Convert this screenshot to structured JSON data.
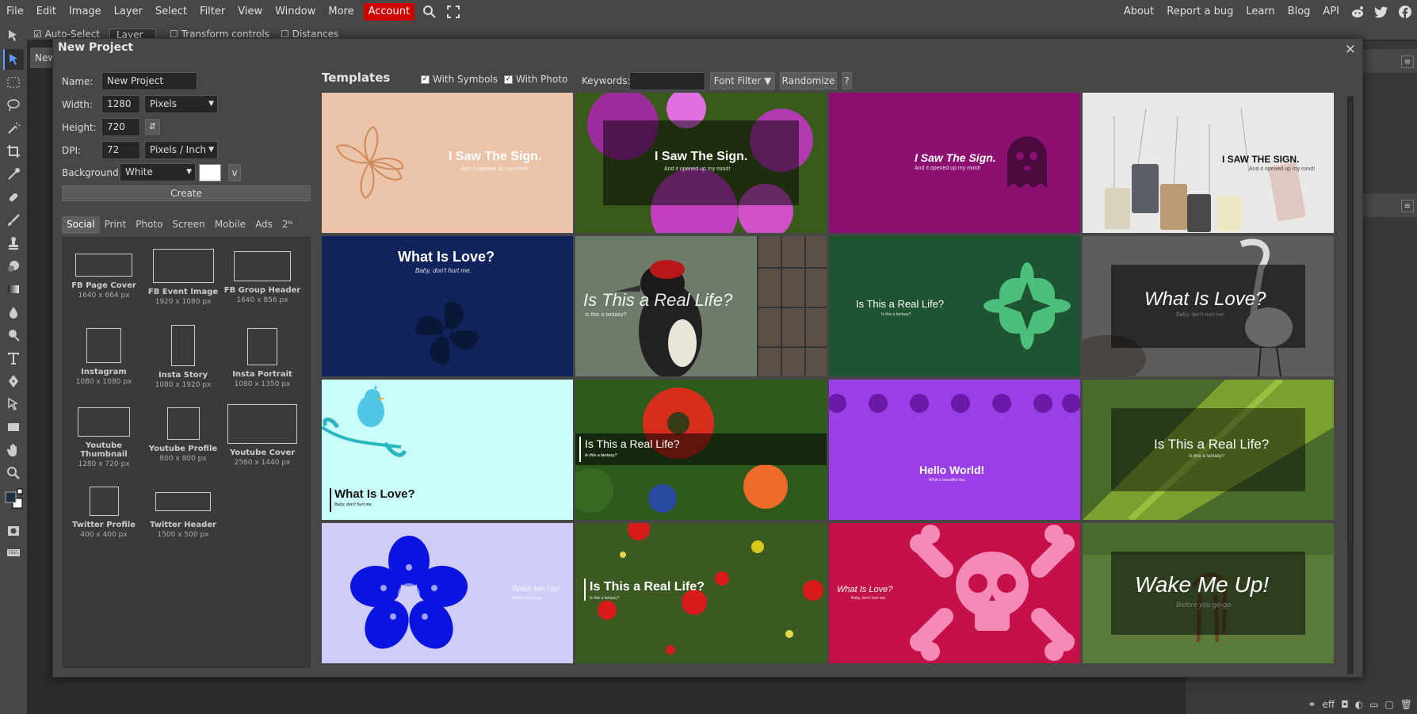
{
  "menubar": {
    "items": [
      "File",
      "Edit",
      "Image",
      "Layer",
      "Select",
      "Filter",
      "View",
      "Window",
      "More"
    ],
    "account": "Account",
    "right_links": [
      "About",
      "Report a bug",
      "Learn",
      "Blog",
      "API"
    ],
    "accent_color": "#d00000"
  },
  "optionsbar": {
    "auto_select": "Auto-Select",
    "layer": "Layer",
    "transform_controls": "Transform controls",
    "distances": "Distances"
  },
  "workspace_tab": "New",
  "dialog": {
    "title": "New Project",
    "close": "×",
    "name_label": "Name:",
    "name_value": "New Project",
    "width_label": "Width:",
    "width_value": "1280",
    "width_unit": "Pixels",
    "height_label": "Height:",
    "height_value": "720",
    "swap_icon": "⇵",
    "dpi_label": "DPI:",
    "dpi_value": "72",
    "dpi_unit": "Pixels / Inch",
    "background_label": "Background:",
    "background_value": "White",
    "background_color": "#ffffff",
    "v_button": "v",
    "create": "Create",
    "preset_tabs": [
      "Social",
      "Print",
      "Photo",
      "Screen",
      "Mobile",
      "Ads",
      "2ᴺ"
    ],
    "presets": [
      {
        "name": "FB Page Cover",
        "size": "1640 x 664 px"
      },
      {
        "name": "FB Event Image",
        "size": "1920 x 1080 px"
      },
      {
        "name": "FB Group Header",
        "size": "1640 x 856 px"
      },
      {
        "name": "Instagram",
        "size": "1080 x 1080 px"
      },
      {
        "name": "Insta Story",
        "size": "1080 x 1920 px"
      },
      {
        "name": "Insta Portrait",
        "size": "1080 x 1350 px"
      },
      {
        "name": "Youtube Thumbnail",
        "size": "1280 x 720 px"
      },
      {
        "name": "Youtube Profile",
        "size": "800 x 800 px"
      },
      {
        "name": "Youtube Cover",
        "size": "2560 x 1440 px"
      },
      {
        "name": "Twitter Profile",
        "size": "400 x 400 px"
      },
      {
        "name": "Twitter Header",
        "size": "1500 x 500 px"
      }
    ],
    "templates_label": "Templates",
    "with_symbols": "With Symbols",
    "with_photo": "With Photo",
    "keywords_label": "Keywords:",
    "font_filter": "Font Filter ▼",
    "randomize": "Randomize",
    "help": "?"
  },
  "templates": [
    {
      "title": "I Saw The Sign.",
      "sub": "And it opened up my mind!",
      "bg": "#ebc3a8"
    },
    {
      "title": "I Saw The Sign.",
      "sub": "And it opened up my mind!",
      "bg": "#5a2a5a"
    },
    {
      "title": "I Saw The Sign.",
      "sub": "And it opened up my mind!",
      "bg": "#8b1070"
    },
    {
      "title": "I SAW THE SIGN.",
      "sub": "And it opened up my mind!",
      "bg": "#e8e8e6"
    },
    {
      "title": "What Is Love?",
      "sub": "Baby, don't hurt me.",
      "bg": "#10235a"
    },
    {
      "title": "Is This a Real Life?",
      "sub": "Is this a fantasy?",
      "bg": "#6e7a6a"
    },
    {
      "title": "Is This a Real Life?",
      "sub": "Is this a fantasy?",
      "bg": "#1f5433"
    },
    {
      "title": "What Is Love?",
      "sub": "Baby, don't hurt me.",
      "bg": "#5e5d5c"
    },
    {
      "title": "What Is Love?",
      "sub": "Baby, don't hurt me.",
      "bg": "#c9fcfa"
    },
    {
      "title": "Is This a Real Life?",
      "sub": "Is this a fantasy?",
      "bg": "#2f5a1e"
    },
    {
      "title": "Hello World!",
      "sub": "What a beautiful day.",
      "bg": "#9a3fe6"
    },
    {
      "title": "Is This a Real Life?",
      "sub": "Is this a fantasy?",
      "bg": "#4a6a2a"
    },
    {
      "title": "Wake Me Up!",
      "sub": "Before you go-go.",
      "bg": "#cfcdf8"
    },
    {
      "title": "Is This a Real Life?",
      "sub": "Is this a fantasy?",
      "bg": "#3a5a22"
    },
    {
      "title": "What Is Love?",
      "sub": "Baby, don't hurt me.",
      "bg": "#c41148"
    },
    {
      "title": "Wake Me Up!",
      "sub": "Before you go-go.",
      "bg": "#5a6e3a"
    }
  ]
}
